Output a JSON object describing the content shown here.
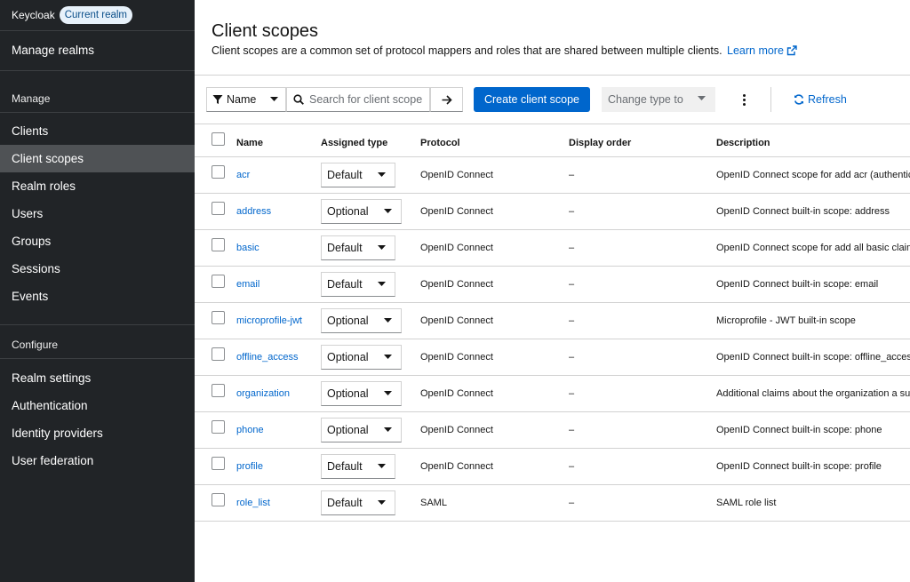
{
  "brand": {
    "name": "Keycloak",
    "realm_badge": "Current realm"
  },
  "sidebar": {
    "manage_realms": "Manage realms",
    "section_manage": "Manage",
    "manage_items": [
      {
        "label": "Clients"
      },
      {
        "label": "Client scopes",
        "active": true
      },
      {
        "label": "Realm roles"
      },
      {
        "label": "Users"
      },
      {
        "label": "Groups"
      },
      {
        "label": "Sessions"
      },
      {
        "label": "Events"
      }
    ],
    "section_configure": "Configure",
    "configure_items": [
      {
        "label": "Realm settings"
      },
      {
        "label": "Authentication"
      },
      {
        "label": "Identity providers"
      },
      {
        "label": "User federation"
      }
    ]
  },
  "header": {
    "title": "Client scopes",
    "description": "Client scopes are a common set of protocol mappers and roles that are shared between multiple clients.",
    "learn_more": "Learn more"
  },
  "toolbar": {
    "filter_label": "Name",
    "search_placeholder": "Search for client scope",
    "create_label": "Create client scope",
    "change_type_label": "Change type to",
    "refresh_label": "Refresh"
  },
  "table": {
    "columns": [
      "Name",
      "Assigned type",
      "Protocol",
      "Display order",
      "Description"
    ],
    "rows": [
      {
        "name": "acr",
        "type": "Default",
        "protocol": "OpenID Connect",
        "order": "–",
        "description": "OpenID Connect scope for add acr (authentication context class reference) to the token"
      },
      {
        "name": "address",
        "type": "Optional",
        "protocol": "OpenID Connect",
        "order": "–",
        "description": "OpenID Connect built-in scope: address"
      },
      {
        "name": "basic",
        "type": "Default",
        "protocol": "OpenID Connect",
        "order": "–",
        "description": "OpenID Connect scope for add all basic claims to the token"
      },
      {
        "name": "email",
        "type": "Default",
        "protocol": "OpenID Connect",
        "order": "–",
        "description": "OpenID Connect built-in scope: email"
      },
      {
        "name": "microprofile-jwt",
        "type": "Optional",
        "protocol": "OpenID Connect",
        "order": "–",
        "description": "Microprofile - JWT built-in scope"
      },
      {
        "name": "offline_access",
        "type": "Optional",
        "protocol": "OpenID Connect",
        "order": "–",
        "description": "OpenID Connect built-in scope: offline_access"
      },
      {
        "name": "organization",
        "type": "Optional",
        "protocol": "OpenID Connect",
        "order": "–",
        "description": "Additional claims about the organization a subject belongs to"
      },
      {
        "name": "phone",
        "type": "Optional",
        "protocol": "OpenID Connect",
        "order": "–",
        "description": "OpenID Connect built-in scope: phone"
      },
      {
        "name": "profile",
        "type": "Default",
        "protocol": "OpenID Connect",
        "order": "–",
        "description": "OpenID Connect built-in scope: profile"
      },
      {
        "name": "role_list",
        "type": "Default",
        "protocol": "SAML",
        "order": "–",
        "description": "SAML role list"
      }
    ]
  },
  "colors": {
    "sidebar_bg": "#212427",
    "sidebar_active": "#4f5255",
    "primary": "#0066cc",
    "link": "#0066cc"
  },
  "icons": {
    "filter": "filter-icon",
    "search": "search-icon",
    "arrow": "arrow-right-icon",
    "kebab": "kebab-icon",
    "refresh": "refresh-icon",
    "external": "external-link-icon",
    "caret": "caret-down-icon"
  }
}
